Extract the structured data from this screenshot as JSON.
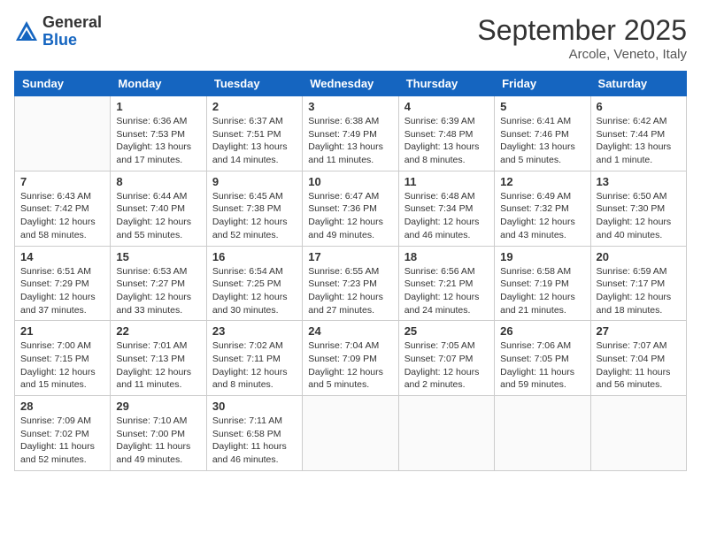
{
  "logo": {
    "general": "General",
    "blue": "Blue"
  },
  "header": {
    "month": "September 2025",
    "location": "Arcole, Veneto, Italy"
  },
  "days_of_week": [
    "Sunday",
    "Monday",
    "Tuesday",
    "Wednesday",
    "Thursday",
    "Friday",
    "Saturday"
  ],
  "weeks": [
    [
      {
        "day": "",
        "info": ""
      },
      {
        "day": "1",
        "info": "Sunrise: 6:36 AM\nSunset: 7:53 PM\nDaylight: 13 hours\nand 17 minutes."
      },
      {
        "day": "2",
        "info": "Sunrise: 6:37 AM\nSunset: 7:51 PM\nDaylight: 13 hours\nand 14 minutes."
      },
      {
        "day": "3",
        "info": "Sunrise: 6:38 AM\nSunset: 7:49 PM\nDaylight: 13 hours\nand 11 minutes."
      },
      {
        "day": "4",
        "info": "Sunrise: 6:39 AM\nSunset: 7:48 PM\nDaylight: 13 hours\nand 8 minutes."
      },
      {
        "day": "5",
        "info": "Sunrise: 6:41 AM\nSunset: 7:46 PM\nDaylight: 13 hours\nand 5 minutes."
      },
      {
        "day": "6",
        "info": "Sunrise: 6:42 AM\nSunset: 7:44 PM\nDaylight: 13 hours\nand 1 minute."
      }
    ],
    [
      {
        "day": "7",
        "info": "Sunrise: 6:43 AM\nSunset: 7:42 PM\nDaylight: 12 hours\nand 58 minutes."
      },
      {
        "day": "8",
        "info": "Sunrise: 6:44 AM\nSunset: 7:40 PM\nDaylight: 12 hours\nand 55 minutes."
      },
      {
        "day": "9",
        "info": "Sunrise: 6:45 AM\nSunset: 7:38 PM\nDaylight: 12 hours\nand 52 minutes."
      },
      {
        "day": "10",
        "info": "Sunrise: 6:47 AM\nSunset: 7:36 PM\nDaylight: 12 hours\nand 49 minutes."
      },
      {
        "day": "11",
        "info": "Sunrise: 6:48 AM\nSunset: 7:34 PM\nDaylight: 12 hours\nand 46 minutes."
      },
      {
        "day": "12",
        "info": "Sunrise: 6:49 AM\nSunset: 7:32 PM\nDaylight: 12 hours\nand 43 minutes."
      },
      {
        "day": "13",
        "info": "Sunrise: 6:50 AM\nSunset: 7:30 PM\nDaylight: 12 hours\nand 40 minutes."
      }
    ],
    [
      {
        "day": "14",
        "info": "Sunrise: 6:51 AM\nSunset: 7:29 PM\nDaylight: 12 hours\nand 37 minutes."
      },
      {
        "day": "15",
        "info": "Sunrise: 6:53 AM\nSunset: 7:27 PM\nDaylight: 12 hours\nand 33 minutes."
      },
      {
        "day": "16",
        "info": "Sunrise: 6:54 AM\nSunset: 7:25 PM\nDaylight: 12 hours\nand 30 minutes."
      },
      {
        "day": "17",
        "info": "Sunrise: 6:55 AM\nSunset: 7:23 PM\nDaylight: 12 hours\nand 27 minutes."
      },
      {
        "day": "18",
        "info": "Sunrise: 6:56 AM\nSunset: 7:21 PM\nDaylight: 12 hours\nand 24 minutes."
      },
      {
        "day": "19",
        "info": "Sunrise: 6:58 AM\nSunset: 7:19 PM\nDaylight: 12 hours\nand 21 minutes."
      },
      {
        "day": "20",
        "info": "Sunrise: 6:59 AM\nSunset: 7:17 PM\nDaylight: 12 hours\nand 18 minutes."
      }
    ],
    [
      {
        "day": "21",
        "info": "Sunrise: 7:00 AM\nSunset: 7:15 PM\nDaylight: 12 hours\nand 15 minutes."
      },
      {
        "day": "22",
        "info": "Sunrise: 7:01 AM\nSunset: 7:13 PM\nDaylight: 12 hours\nand 11 minutes."
      },
      {
        "day": "23",
        "info": "Sunrise: 7:02 AM\nSunset: 7:11 PM\nDaylight: 12 hours\nand 8 minutes."
      },
      {
        "day": "24",
        "info": "Sunrise: 7:04 AM\nSunset: 7:09 PM\nDaylight: 12 hours\nand 5 minutes."
      },
      {
        "day": "25",
        "info": "Sunrise: 7:05 AM\nSunset: 7:07 PM\nDaylight: 12 hours\nand 2 minutes."
      },
      {
        "day": "26",
        "info": "Sunrise: 7:06 AM\nSunset: 7:05 PM\nDaylight: 11 hours\nand 59 minutes."
      },
      {
        "day": "27",
        "info": "Sunrise: 7:07 AM\nSunset: 7:04 PM\nDaylight: 11 hours\nand 56 minutes."
      }
    ],
    [
      {
        "day": "28",
        "info": "Sunrise: 7:09 AM\nSunset: 7:02 PM\nDaylight: 11 hours\nand 52 minutes."
      },
      {
        "day": "29",
        "info": "Sunrise: 7:10 AM\nSunset: 7:00 PM\nDaylight: 11 hours\nand 49 minutes."
      },
      {
        "day": "30",
        "info": "Sunrise: 7:11 AM\nSunset: 6:58 PM\nDaylight: 11 hours\nand 46 minutes."
      },
      {
        "day": "",
        "info": ""
      },
      {
        "day": "",
        "info": ""
      },
      {
        "day": "",
        "info": ""
      },
      {
        "day": "",
        "info": ""
      }
    ]
  ]
}
